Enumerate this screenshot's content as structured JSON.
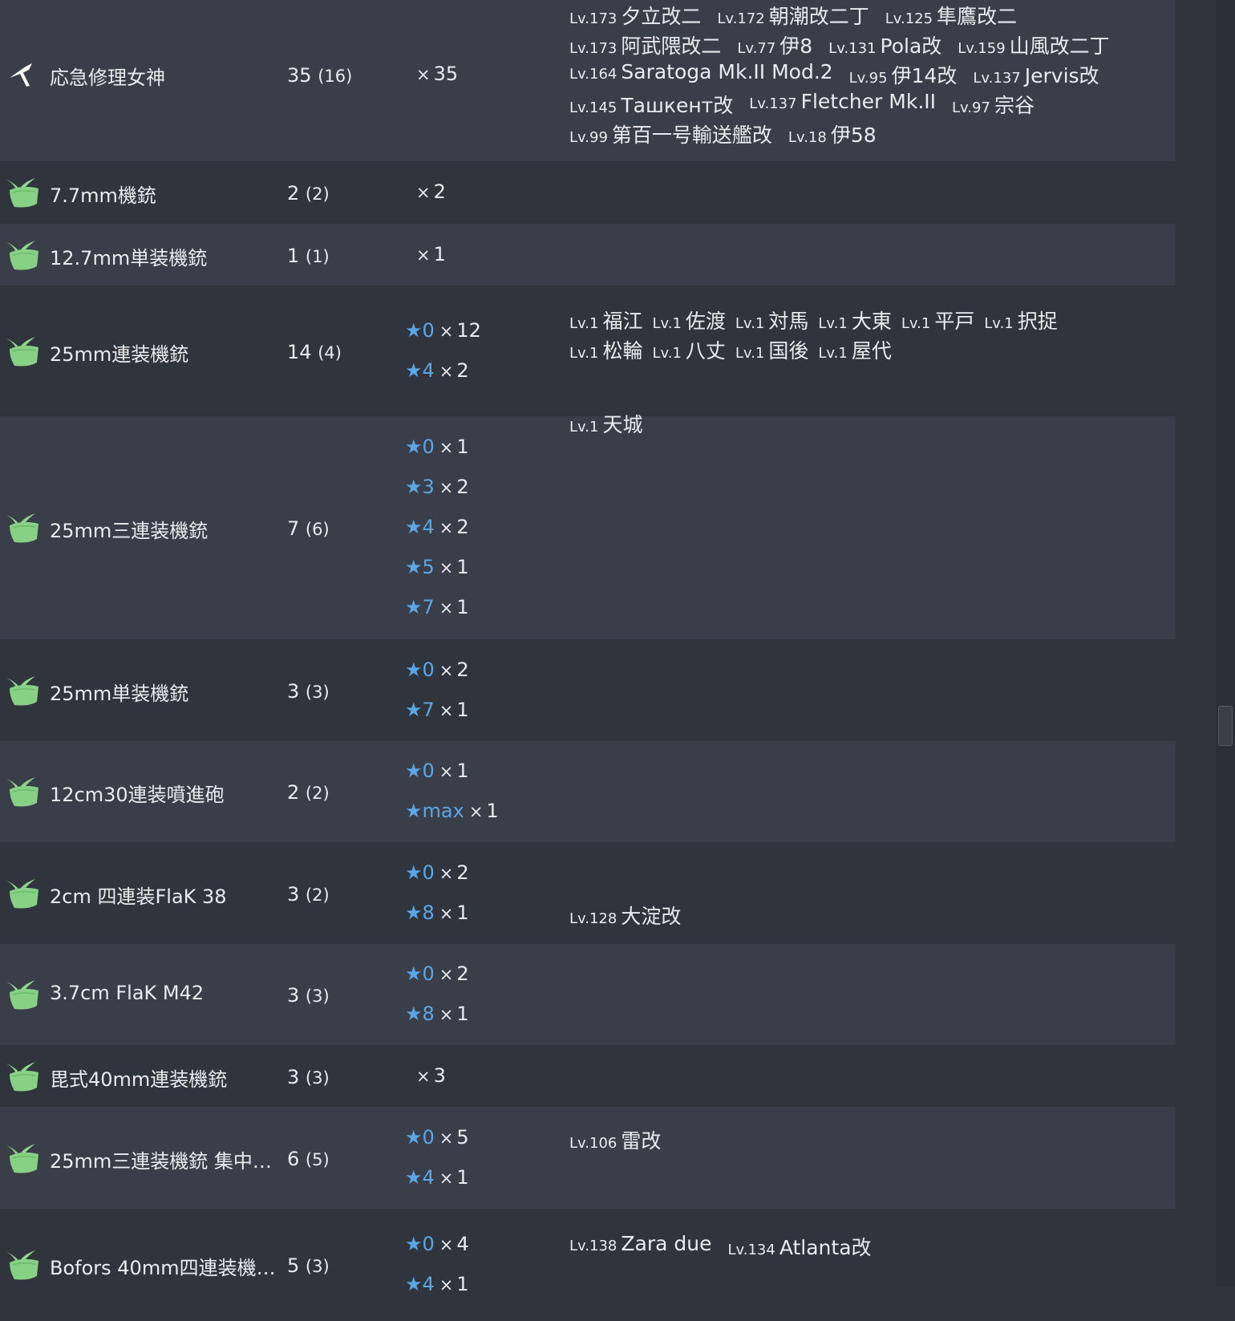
{
  "equipment": [
    {
      "name": "応急修理女神",
      "icon": "repair-goddess-icon",
      "count": "35",
      "held": "(16)",
      "levels": [
        {
          "star": "",
          "level": "",
          "qty": "35"
        }
      ],
      "ships": [
        [
          {
            "lv": "Lv.173",
            "name": "夕立改二"
          },
          {
            "lv": "Lv.172",
            "name": "朝潮改二丁"
          },
          {
            "lv": "Lv.125",
            "name": "隼鷹改二"
          }
        ],
        [
          {
            "lv": "Lv.173",
            "name": "阿武隈改二"
          },
          {
            "lv": "Lv.77",
            "name": "伊8"
          },
          {
            "lv": "Lv.131",
            "name": "Pola改"
          },
          {
            "lv": "Lv.159",
            "name": "山風改二丁"
          }
        ],
        [
          {
            "lv": "Lv.164",
            "name": "Saratoga Mk.II Mod.2"
          },
          {
            "lv": "Lv.95",
            "name": "伊14改"
          },
          {
            "lv": "Lv.137",
            "name": "Jervis改"
          }
        ],
        [
          {
            "lv": "Lv.145",
            "name": "Ташкент改"
          },
          {
            "lv": "Lv.137",
            "name": "Fletcher Mk.II"
          },
          {
            "lv": "Lv.97",
            "name": "宗谷"
          }
        ],
        [
          {
            "lv": "Lv.99",
            "name": "第百一号輸送艦改"
          },
          {
            "lv": "Lv.18",
            "name": "伊58"
          }
        ]
      ]
    },
    {
      "name": "7.7mm機銃",
      "icon": "aa-gun-icon",
      "count": "2",
      "held": "(2)",
      "levels": [
        {
          "star": "",
          "level": "",
          "qty": "2"
        }
      ],
      "ships": []
    },
    {
      "name": "12.7mm単装機銃",
      "icon": "aa-gun-icon",
      "count": "1",
      "held": "(1)",
      "levels": [
        {
          "star": "",
          "level": "",
          "qty": "1"
        }
      ],
      "ships": []
    },
    {
      "name": "25mm連装機銃",
      "icon": "aa-gun-icon",
      "count": "14",
      "held": "(4)",
      "levels": [
        {
          "star": "★",
          "level": "0",
          "qty": "12"
        },
        {
          "star": "★",
          "level": "4",
          "qty": "2"
        }
      ],
      "ships": [
        [
          {
            "lv": "Lv.1",
            "name": "福江"
          },
          {
            "lv": "Lv.1",
            "name": "佐渡"
          },
          {
            "lv": "Lv.1",
            "name": "対馬"
          },
          {
            "lv": "Lv.1",
            "name": "大東"
          },
          {
            "lv": "Lv.1",
            "name": "平戸"
          },
          {
            "lv": "Lv.1",
            "name": "択捉"
          }
        ],
        [
          {
            "lv": "Lv.1",
            "name": "松輪"
          },
          {
            "lv": "Lv.1",
            "name": "八丈"
          },
          {
            "lv": "Lv.1",
            "name": "国後"
          },
          {
            "lv": "Lv.1",
            "name": "屋代"
          }
        ]
      ]
    },
    {
      "name": "25mm三連装機銃",
      "icon": "aa-gun-icon",
      "count": "7",
      "held": "(6)",
      "levels": [
        {
          "star": "★",
          "level": "0",
          "qty": "1"
        },
        {
          "star": "★",
          "level": "3",
          "qty": "2"
        },
        {
          "star": "★",
          "level": "4",
          "qty": "2"
        },
        {
          "star": "★",
          "level": "5",
          "qty": "1"
        },
        {
          "star": "★",
          "level": "7",
          "qty": "1"
        }
      ],
      "ships": [
        [
          {
            "lv": "Lv.1",
            "name": "天城"
          }
        ]
      ]
    },
    {
      "name": "25mm単装機銃",
      "icon": "aa-gun-icon",
      "count": "3",
      "held": "(3)",
      "levels": [
        {
          "star": "★",
          "level": "0",
          "qty": "2"
        },
        {
          "star": "★",
          "level": "7",
          "qty": "1"
        }
      ],
      "ships": []
    },
    {
      "name": "12cm30連装噴進砲",
      "icon": "aa-gun-icon",
      "count": "2",
      "held": "(2)",
      "levels": [
        {
          "star": "★",
          "level": "0",
          "qty": "1"
        },
        {
          "star": "★",
          "level": "max",
          "qty": "1"
        }
      ],
      "ships": []
    },
    {
      "name": "2cm 四連装FlaK 38",
      "icon": "aa-gun-icon",
      "count": "3",
      "held": "(2)",
      "levels": [
        {
          "star": "★",
          "level": "0",
          "qty": "2"
        },
        {
          "star": "★",
          "level": "8",
          "qty": "1"
        }
      ],
      "ships": [
        [
          {
            "lv": "Lv.128",
            "name": "大淀改"
          }
        ]
      ],
      "shipsAlignLevel": 1
    },
    {
      "name": "3.7cm FlaK M42",
      "icon": "aa-gun-icon",
      "count": "3",
      "held": "(3)",
      "levels": [
        {
          "star": "★",
          "level": "0",
          "qty": "2"
        },
        {
          "star": "★",
          "level": "8",
          "qty": "1"
        }
      ],
      "ships": []
    },
    {
      "name": "毘式40mm連装機銃",
      "icon": "aa-gun-icon",
      "count": "3",
      "held": "(3)",
      "levels": [
        {
          "star": "",
          "level": "",
          "qty": "3"
        }
      ],
      "ships": []
    },
    {
      "name": "25mm三連装機銃 集中…",
      "icon": "aa-gun-icon",
      "count": "6",
      "held": "(5)",
      "levels": [
        {
          "star": "★",
          "level": "0",
          "qty": "5"
        },
        {
          "star": "★",
          "level": "4",
          "qty": "1"
        }
      ],
      "ships": [
        [
          {
            "lv": "Lv.106",
            "name": "雷改"
          }
        ]
      ]
    },
    {
      "name": "Bofors 40mm四連装機…",
      "icon": "aa-gun-icon",
      "count": "5",
      "held": "(3)",
      "levels": [
        {
          "star": "★",
          "level": "0",
          "qty": "4"
        },
        {
          "star": "★",
          "level": "4",
          "qty": "1"
        }
      ],
      "ships": [
        [
          {
            "lv": "Lv.138",
            "name": "Zara due"
          },
          {
            "lv": "Lv.134",
            "name": "Atlanta改"
          }
        ]
      ]
    }
  ],
  "symbols": {
    "times": "×"
  }
}
